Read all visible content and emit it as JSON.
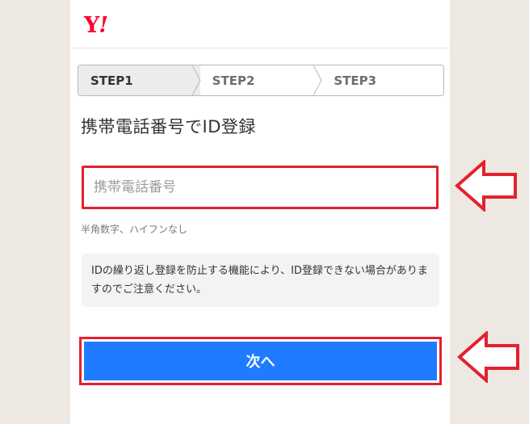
{
  "brand": {
    "logo": "Y!",
    "logo_color": "#ff0033"
  },
  "steps": [
    {
      "label": "STEP1",
      "active": true
    },
    {
      "label": "STEP2",
      "active": false
    },
    {
      "label": "STEP3",
      "active": false
    }
  ],
  "title": "携帯電話番号でID登録",
  "phone_field": {
    "value": "",
    "placeholder": "携帯電話番号"
  },
  "hint": "半角数字、ハイフンなし",
  "notice": "IDの繰り返し登録を防止する機能により、ID登録できない場合がありますのでご注意ください。",
  "next_button": {
    "label": "次へ",
    "color": "#1f7bff"
  },
  "annotation": {
    "highlight_color": "#e5202e",
    "arrow_icon": "left-arrow-icon"
  }
}
